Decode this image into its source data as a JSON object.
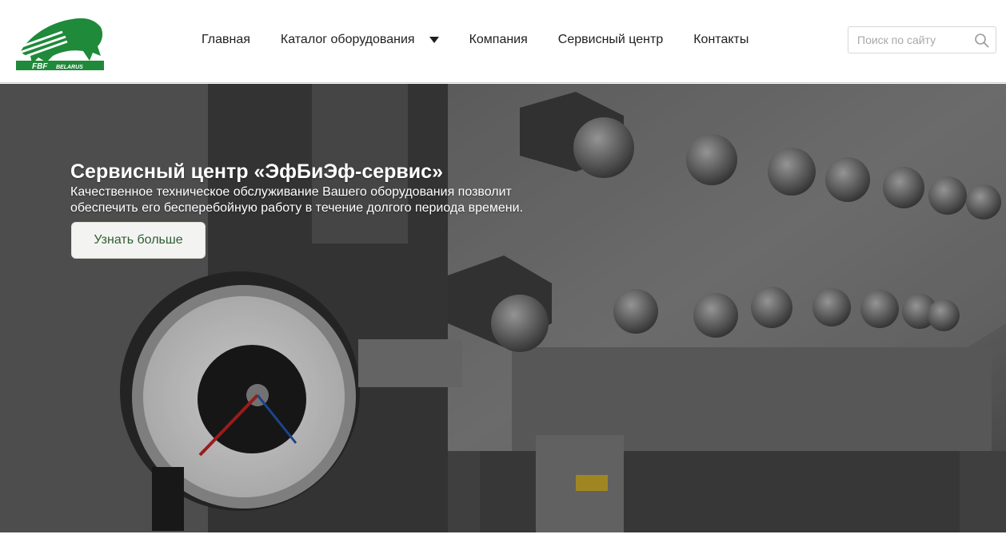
{
  "brand": {
    "logo_text": "FBF",
    "logo_subtext": "BELARUS",
    "green": "#1f8a3a"
  },
  "nav": {
    "items": [
      {
        "label": "Главная"
      },
      {
        "label": "Каталог оборудования",
        "has_dropdown": true
      },
      {
        "label": "Компания"
      },
      {
        "label": "Сервисный центр"
      },
      {
        "label": "Контакты"
      }
    ]
  },
  "search": {
    "placeholder": "Поиск по сайту",
    "value": "",
    "icon": "search-icon"
  },
  "hero": {
    "title": "Сервисный центр «ЭфБиЭф-сервис»",
    "text": "Качественное техническое обслуживание Вашего оборудования позволит обеспечить его бесперебойную работу в течение долгого периода времени.",
    "button_label": "Узнать больше",
    "background": "industrial-homogenizer-photo"
  }
}
